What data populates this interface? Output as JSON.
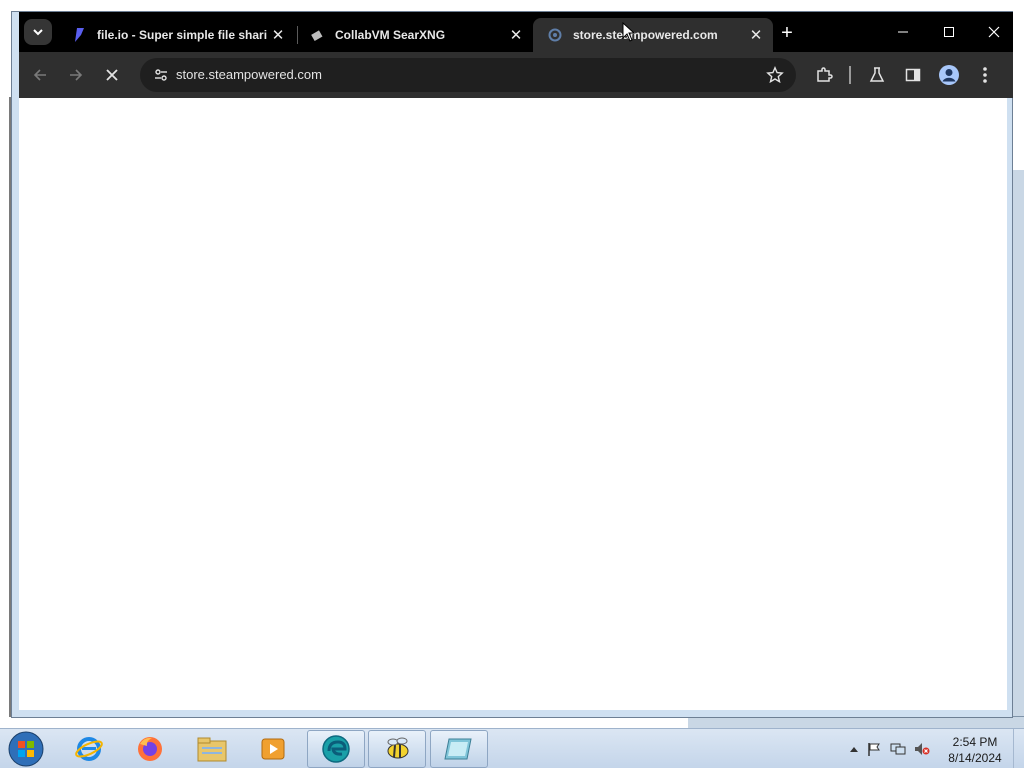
{
  "browser": {
    "tabs": [
      {
        "title": "file.io - Super simple file sharing",
        "favicon": "fileio-icon",
        "active": false
      },
      {
        "title": "CollabVM SearXNG",
        "favicon": "searxng-icon",
        "active": false
      },
      {
        "title": "store.steampowered.com",
        "favicon": "loading-globe-icon",
        "active": true
      }
    ],
    "address_bar": {
      "url": "store.steampowered.com"
    },
    "colors": {
      "tabstrip": "#000000",
      "toolbar": "#2f2f2f",
      "omnibox": "#1f1f1f",
      "profile_accent": "#a8c7fa"
    }
  },
  "taskbar": {
    "apps": [
      "internet-explorer-icon",
      "firefox-icon",
      "file-explorer-icon",
      "media-player-icon",
      "edge-icon",
      "bee-app-icon",
      "notepad-icon"
    ],
    "clock": {
      "time": "2:54 PM",
      "date": "8/14/2024"
    }
  }
}
